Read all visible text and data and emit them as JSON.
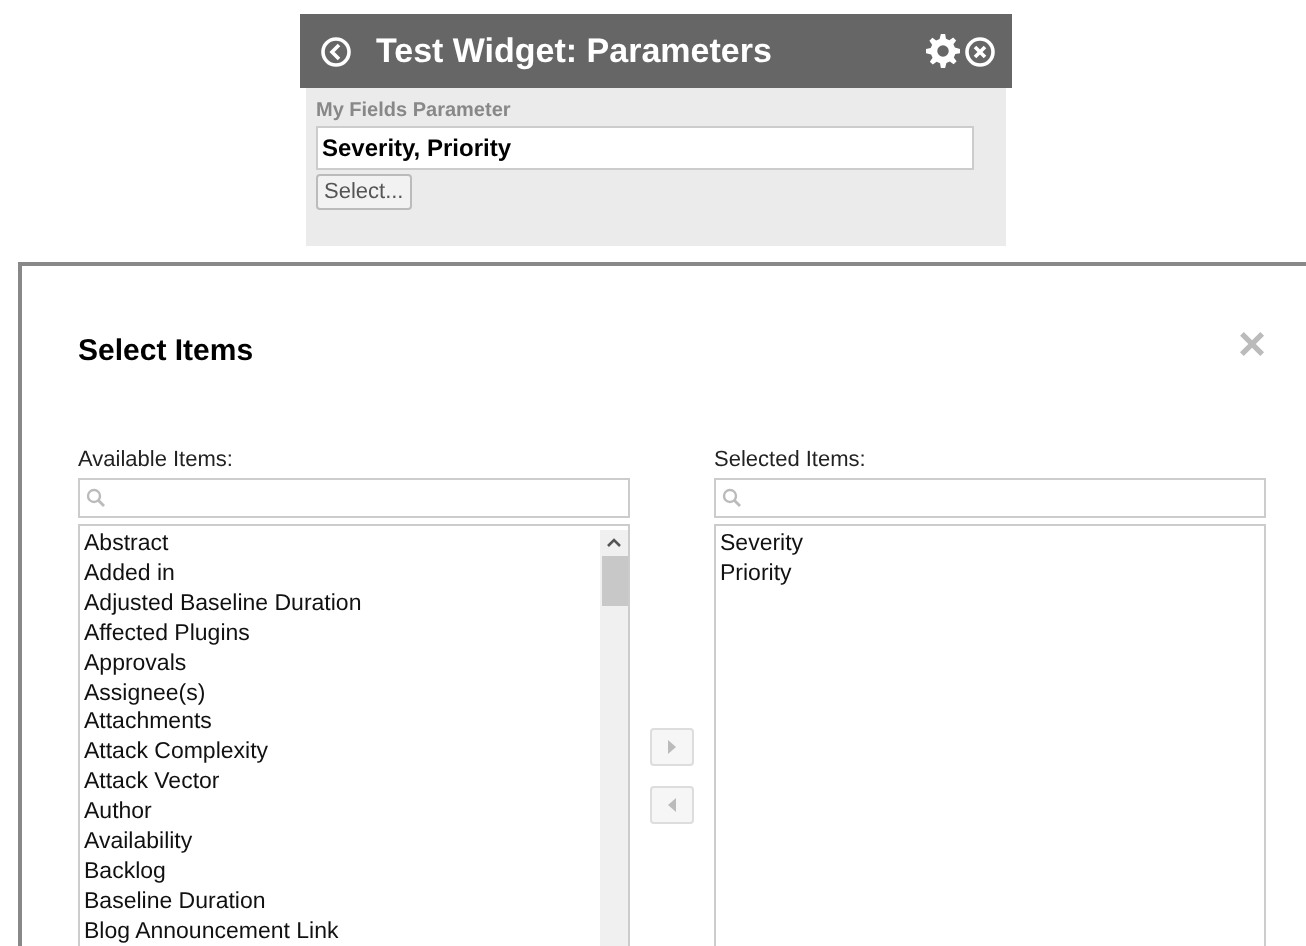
{
  "widget": {
    "title": "Test Widget: Parameters",
    "field_label": "My Fields Parameter",
    "field_value": "Severity, Priority",
    "select_button": "Select..."
  },
  "dialog": {
    "title": "Select Items",
    "close": "×",
    "available": {
      "label": "Available Items:",
      "items": [
        "Abstract",
        "Added in",
        "Adjusted Baseline Duration",
        "Affected Plugins",
        "Approvals",
        "Assignee(s)",
        "Attachments",
        "Attack Complexity",
        "Attack Vector",
        "Author",
        "Availability",
        "Backlog",
        "Baseline Duration",
        "Blog Announcement Link"
      ]
    },
    "selected": {
      "label": "Selected Items:",
      "items": [
        "Severity",
        "Priority"
      ]
    }
  }
}
